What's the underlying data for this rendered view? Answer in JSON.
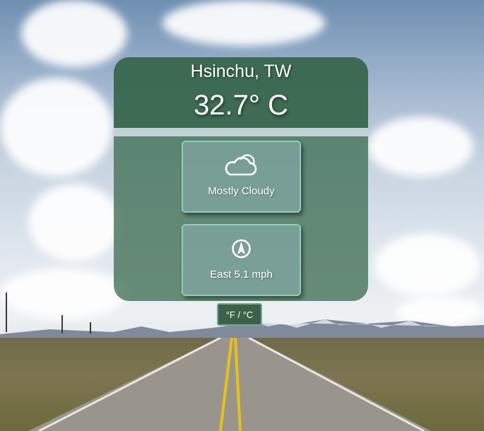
{
  "location": {
    "city": "Hsinchu, TW"
  },
  "temperature": {
    "display": "32.7° C"
  },
  "condition": {
    "icon": "cloud-icon",
    "label": "Mostly Cloudy"
  },
  "wind": {
    "icon": "compass-icon",
    "label": "East 5.1 mph"
  },
  "controls": {
    "unit_toggle_label": "°F / °C"
  },
  "colors": {
    "card": "#3f7054",
    "tile_border": "#8fcfb8",
    "toggle_bg": "#3c6148"
  }
}
